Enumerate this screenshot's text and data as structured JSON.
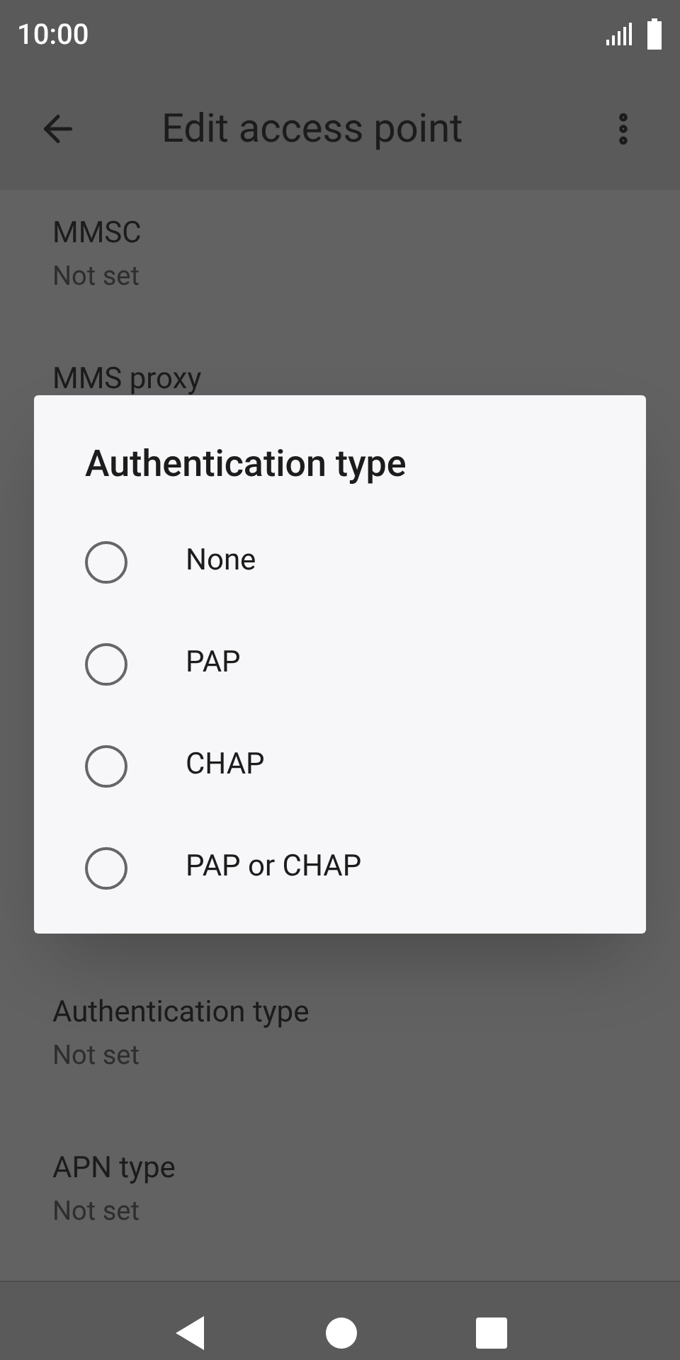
{
  "status_bar": {
    "time": "10:00"
  },
  "app_bar": {
    "title": "Edit access point"
  },
  "settings": [
    {
      "title": "MMSC",
      "value": "Not set"
    },
    {
      "title": "MMS proxy"
    },
    {
      "title": "Authentication type",
      "value": "Not set"
    },
    {
      "title": "APN type",
      "value": "Not set"
    }
  ],
  "dialog": {
    "title": "Authentication type",
    "options": [
      {
        "label": "None",
        "selected": false
      },
      {
        "label": "PAP",
        "selected": false
      },
      {
        "label": "CHAP",
        "selected": false
      },
      {
        "label": "PAP or CHAP",
        "selected": false
      }
    ]
  }
}
